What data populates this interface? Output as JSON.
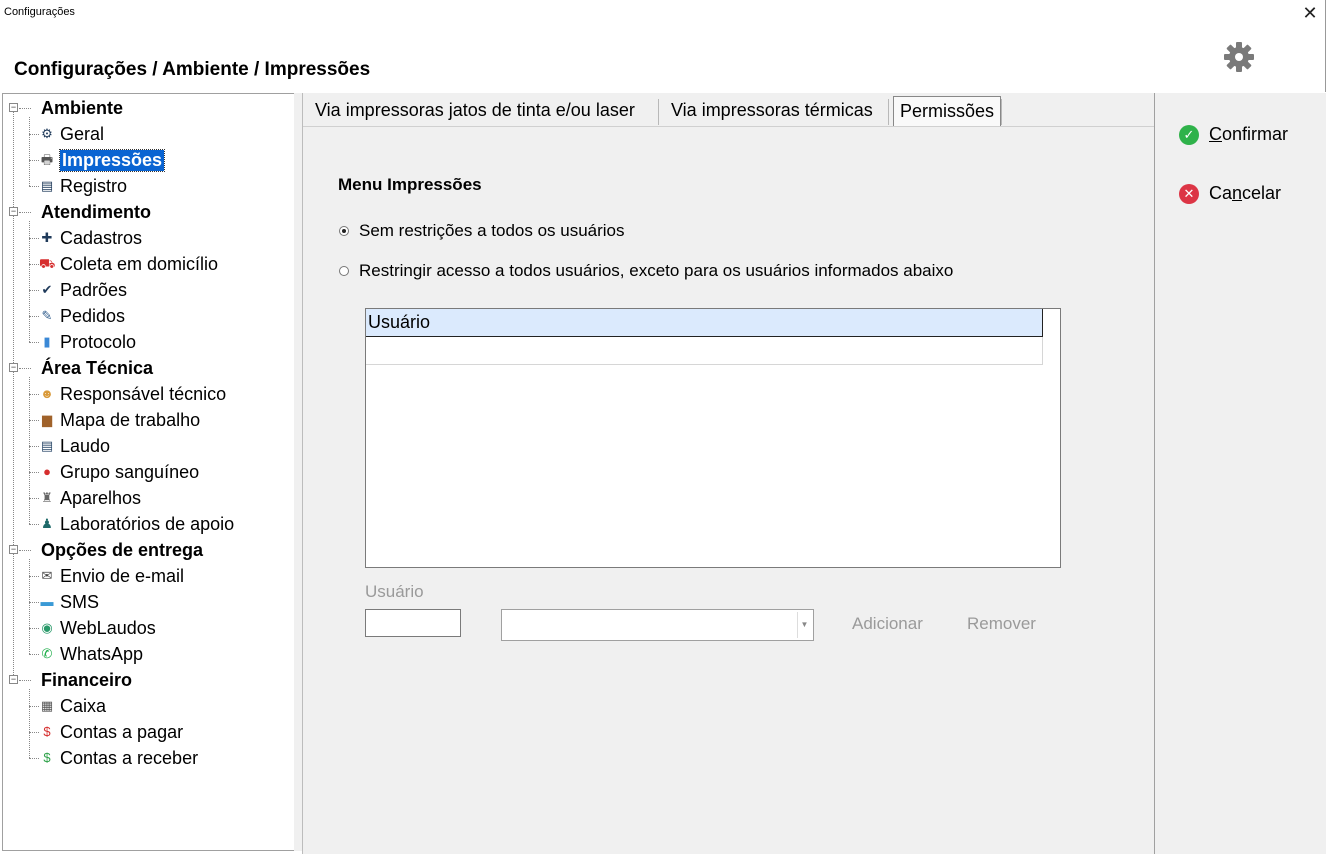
{
  "window": {
    "title": "Configurações",
    "close_glyph": "✕"
  },
  "header": {
    "title": "Configurações / Ambiente / Impressões",
    "gear_icon": "gear-icon"
  },
  "tree": [
    {
      "type": "group",
      "label": "Ambiente"
    },
    {
      "type": "item",
      "label": "Geral",
      "icon": "⚙",
      "color": "#1f3a5a"
    },
    {
      "type": "item",
      "label": "Impressões",
      "icon": "🖶",
      "color": "#555555",
      "selected": true
    },
    {
      "type": "item",
      "label": "Registro",
      "icon": "▤",
      "color": "#1f3a5a"
    },
    {
      "type": "group",
      "label": "Atendimento"
    },
    {
      "type": "item",
      "label": "Cadastros",
      "icon": "✚",
      "color": "#1f3a5a"
    },
    {
      "type": "item",
      "label": "Coleta em domicílio",
      "icon": "⛟",
      "color": "#d62e2e"
    },
    {
      "type": "item",
      "label": "Padrões",
      "icon": "✔",
      "color": "#1f3a5a"
    },
    {
      "type": "item",
      "label": "Pedidos",
      "icon": "✎",
      "color": "#2c5a8a"
    },
    {
      "type": "item",
      "label": "Protocolo",
      "icon": "▮",
      "color": "#3a88d6"
    },
    {
      "type": "group",
      "label": "Área Técnica"
    },
    {
      "type": "item",
      "label": "Responsável técnico",
      "icon": "☻",
      "color": "#d99a3a"
    },
    {
      "type": "item",
      "label": "Mapa de trabalho",
      "icon": "▆",
      "color": "#a0622a"
    },
    {
      "type": "item",
      "label": "Laudo",
      "icon": "▤",
      "color": "#2c4a6a"
    },
    {
      "type": "item",
      "label": "Grupo sanguíneo",
      "icon": "●",
      "color": "#d62e2e"
    },
    {
      "type": "item",
      "label": "Aparelhos",
      "icon": "♜",
      "color": "#666666"
    },
    {
      "type": "item",
      "label": "Laboratórios de apoio",
      "icon": "♟",
      "color": "#1f6a6a"
    },
    {
      "type": "group",
      "label": "Opções de entrega"
    },
    {
      "type": "item",
      "label": "Envio de e-mail",
      "icon": "✉",
      "color": "#444444"
    },
    {
      "type": "item",
      "label": "SMS",
      "icon": "▬",
      "color": "#3a9ad6"
    },
    {
      "type": "item",
      "label": "WebLaudos",
      "icon": "◉",
      "color": "#2a9a6a"
    },
    {
      "type": "item",
      "label": "WhatsApp",
      "icon": "✆",
      "color": "#1fae4a"
    },
    {
      "type": "group",
      "label": "Financeiro"
    },
    {
      "type": "item",
      "label": "Caixa",
      "icon": "▦",
      "color": "#555555"
    },
    {
      "type": "item",
      "label": "Contas a pagar",
      "icon": "$",
      "color": "#d62e2e"
    },
    {
      "type": "item",
      "label": "Contas a receber",
      "icon": "$",
      "color": "#2fa24a"
    }
  ],
  "tabs": [
    {
      "label": "Via impressoras jatos de tinta e/ou laser",
      "active": false
    },
    {
      "label": "Via impressoras térmicas",
      "active": false
    },
    {
      "label": "Permissões",
      "active": true
    }
  ],
  "permissions": {
    "section_title": "Menu Impressões",
    "options": [
      {
        "label": "Sem restrições a todos os usuários",
        "checked": true
      },
      {
        "label": "Restringir acesso a todos usuários, exceto para os usuários informados abaixo",
        "checked": false
      }
    ],
    "grid": {
      "columns": [
        "Usuário"
      ],
      "rows": []
    },
    "user_label": "Usuário",
    "user_code_value": "",
    "user_select_value": "",
    "add_label": "Adicionar",
    "remove_label": "Remover"
  },
  "actions": {
    "confirm_label_prefix": "",
    "confirm_mnemonic": "C",
    "confirm_label_rest": "onfirmar",
    "cancel_label_prefix": "Ca",
    "cancel_mnemonic": "n",
    "cancel_label_rest": "celar"
  }
}
